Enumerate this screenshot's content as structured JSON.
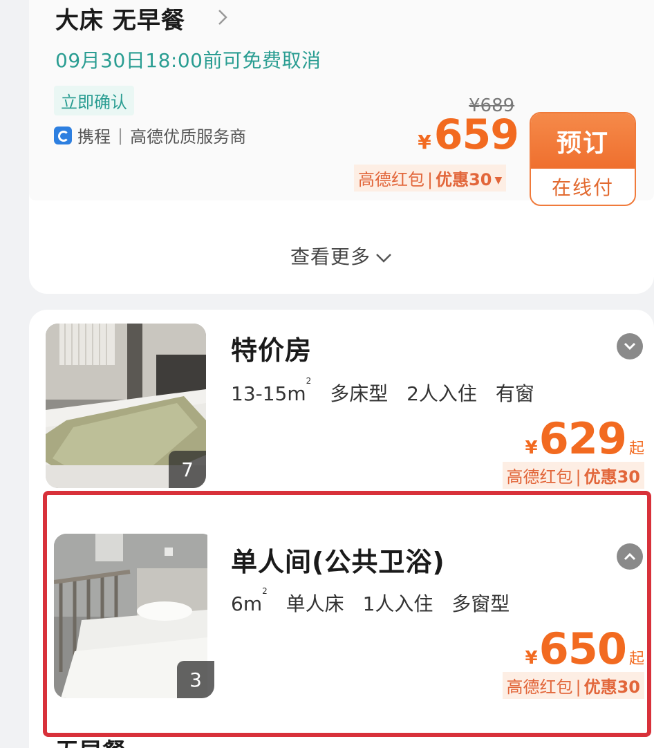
{
  "rate_card": {
    "room_name": "大床 无早餐",
    "cancel_policy": "09月30日18:00前可免费取消",
    "instant_confirm": "立即确认",
    "supplier_name": "携程",
    "supplier_sep": "|",
    "supplier_desc": "高德优质服务商",
    "original_price": "¥689",
    "currency": "¥",
    "price": "659",
    "discount_source": "高德红包",
    "discount_sep": "|",
    "discount_amount": "优惠30",
    "book_label": "预订",
    "pay_label": "在线付",
    "see_more": "查看更多"
  },
  "rooms": [
    {
      "title": "特价房",
      "size": "13-15m",
      "sup": "2",
      "bed": "多床型",
      "occupancy": "2人入住",
      "window": "有窗",
      "currency": "¥",
      "price": "629",
      "price_suffix": "起",
      "discount_source": "高德红包",
      "discount_sep": "|",
      "discount_amount": "优惠30",
      "photo_count": "7",
      "expanded": false
    },
    {
      "title": "单人间(公共卫浴)",
      "size": "6m",
      "sup": "2",
      "bed": "单人床",
      "occupancy": "1人入住",
      "window": "多窗型",
      "currency": "¥",
      "price": "650",
      "price_suffix": "起",
      "discount_source": "高德红包",
      "discount_sep": "|",
      "discount_amount": "优惠30",
      "photo_count": "3",
      "expanded": true
    }
  ],
  "next_peek": "无早餐",
  "colors": {
    "accent_orange": "#f26a20",
    "teal": "#2a9d92",
    "highlight_red": "#d8313a"
  }
}
